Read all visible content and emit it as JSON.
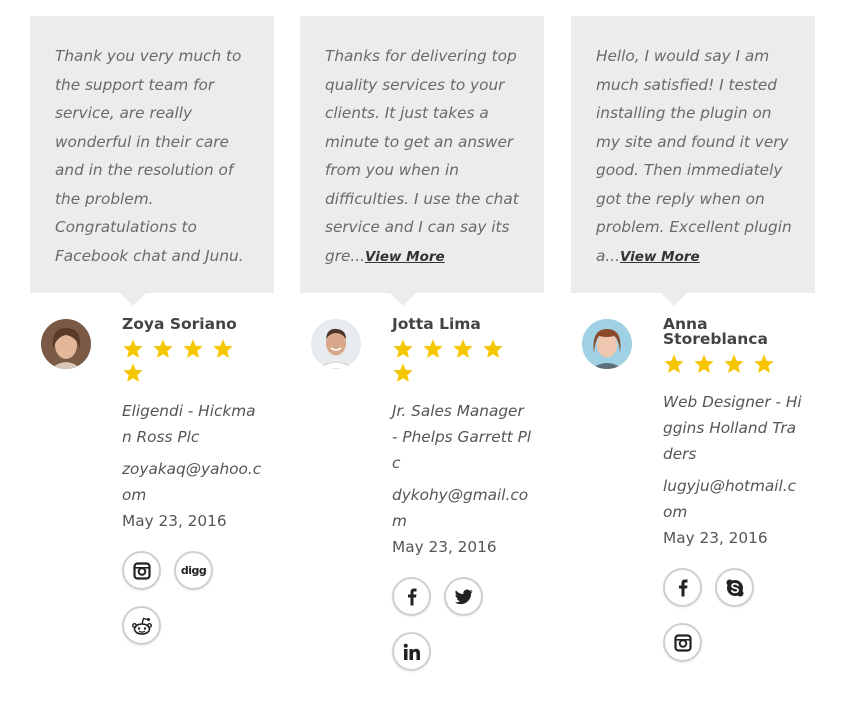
{
  "colors": {
    "star": "#f7c600",
    "bubble_bg": "#ececec",
    "icon_border": "#cfcfcf"
  },
  "testimonials": [
    {
      "quote": "Thank you very much to the support team for service, are really wonderful in their care and in the resolution of the problem. Congratulations to Facebook chat and Junu.",
      "view_more": "",
      "name": "Zoya Soriano",
      "rating": 5,
      "company": "Eligendi - Hickman Ross Plc",
      "email": "zoyakaq@yahoo.com",
      "date": "May 23, 2016",
      "socials": [
        "instagram-icon",
        "digg-icon",
        "reddit-icon"
      ]
    },
    {
      "quote": "Thanks for delivering top quality services to your clients. It just takes a minute to get an answer from you when in difficulties. I use the chat service and I can say its gre...",
      "view_more": "View More",
      "name": "Jotta Lima",
      "rating": 5,
      "company": "Jr. Sales Manager - Phelps Garrett Plc",
      "email": "dykohy@gmail.com",
      "date": "May 23, 2016",
      "socials": [
        "facebook-icon",
        "twitter-icon",
        "linkedin-icon"
      ]
    },
    {
      "quote": "Hello, I would say I am much satisfied! I tested installing the plugin on my site and found it very good. Then immediately got the reply when on problem. Excellent plugin a...",
      "view_more": "View More",
      "name": "Anna Storeblanca",
      "rating": 4,
      "company": "Web Designer - Higgins Holland Traders",
      "email": "lugyju@hotmail.com",
      "date": "May 23, 2016",
      "socials": [
        "facebook-icon",
        "skype-icon",
        "instagram-icon"
      ]
    }
  ]
}
